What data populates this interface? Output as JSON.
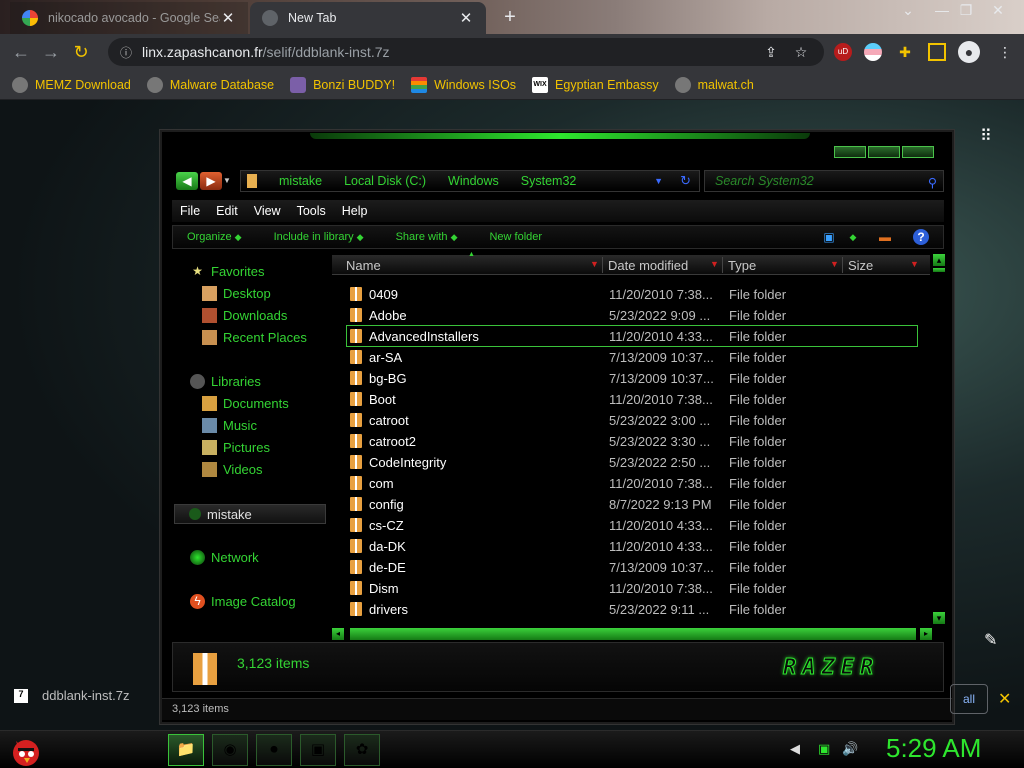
{
  "browser": {
    "tabs": [
      {
        "title": "nikocado avocado - Google Sear",
        "active": false
      },
      {
        "title": "New Tab",
        "active": true
      }
    ],
    "url_host": "linx.zapashcanon.fr",
    "url_path": "/selif/ddblank-inst.7z",
    "bookmarks": [
      {
        "label": "MEMZ Download",
        "icon": "globe-icon"
      },
      {
        "label": "Malware Database",
        "icon": "globe-icon"
      },
      {
        "label": "Bonzi BUDDY!",
        "icon": "bonzi-icon"
      },
      {
        "label": "Windows ISOs",
        "icon": "windows-rainbow-icon"
      },
      {
        "label": "Egyptian Embassy",
        "icon": "wix-icon"
      },
      {
        "label": "malwat.ch",
        "icon": "globe-icon"
      }
    ]
  },
  "explorer": {
    "breadcrumb": [
      "mistake",
      "Local Disk (C:)",
      "Windows",
      "System32"
    ],
    "search_placeholder": "Search System32",
    "menu": [
      "File",
      "Edit",
      "View",
      "Tools",
      "Help"
    ],
    "commands": [
      "Organize",
      "Include in library",
      "Share with",
      "New folder"
    ],
    "nav": {
      "favorites": "Favorites",
      "favorites_items": [
        "Desktop",
        "Downloads",
        "Recent Places"
      ],
      "libraries": "Libraries",
      "libraries_items": [
        "Documents",
        "Music",
        "Pictures",
        "Videos"
      ],
      "homegroup": "mistake",
      "network": "Network",
      "image_catalog": "Image Catalog"
    },
    "columns": [
      "Name",
      "Date modified",
      "Type",
      "Size"
    ],
    "files": [
      {
        "name": "0409",
        "date": "11/20/2010 7:38...",
        "type": "File folder"
      },
      {
        "name": "Adobe",
        "date": "5/23/2022 9:09 ...",
        "type": "File folder"
      },
      {
        "name": "AdvancedInstallers",
        "date": "11/20/2010 4:33...",
        "type": "File folder",
        "selected": true
      },
      {
        "name": "ar-SA",
        "date": "7/13/2009 10:37...",
        "type": "File folder"
      },
      {
        "name": "bg-BG",
        "date": "7/13/2009 10:37...",
        "type": "File folder"
      },
      {
        "name": "Boot",
        "date": "11/20/2010 7:38...",
        "type": "File folder"
      },
      {
        "name": "catroot",
        "date": "5/23/2022 3:00 ...",
        "type": "File folder"
      },
      {
        "name": "catroot2",
        "date": "5/23/2022 3:30 ...",
        "type": "File folder"
      },
      {
        "name": "CodeIntegrity",
        "date": "5/23/2022 2:50 ...",
        "type": "File folder"
      },
      {
        "name": "com",
        "date": "11/20/2010 7:38...",
        "type": "File folder"
      },
      {
        "name": "config",
        "date": "8/7/2022 9:13 PM",
        "type": "File folder"
      },
      {
        "name": "cs-CZ",
        "date": "11/20/2010 4:33...",
        "type": "File folder"
      },
      {
        "name": "da-DK",
        "date": "11/20/2010 4:33...",
        "type": "File folder"
      },
      {
        "name": "de-DE",
        "date": "7/13/2009 10:37...",
        "type": "File folder"
      },
      {
        "name": "Dism",
        "date": "11/20/2010 7:38...",
        "type": "File folder"
      },
      {
        "name": "drivers",
        "date": "5/23/2022 9:11 ...",
        "type": "File folder"
      }
    ],
    "item_count": "3,123 items",
    "status_text": "3,123 items",
    "logo": "RAZER"
  },
  "download": {
    "filename": "ddblank-inst.7z",
    "show_all": "all"
  },
  "taskbar": {
    "time": "5:29 AM"
  },
  "colors": {
    "accent_green": "#2ee62e",
    "bookmark_text": "#f2c300",
    "list_text": "#ffffff"
  }
}
